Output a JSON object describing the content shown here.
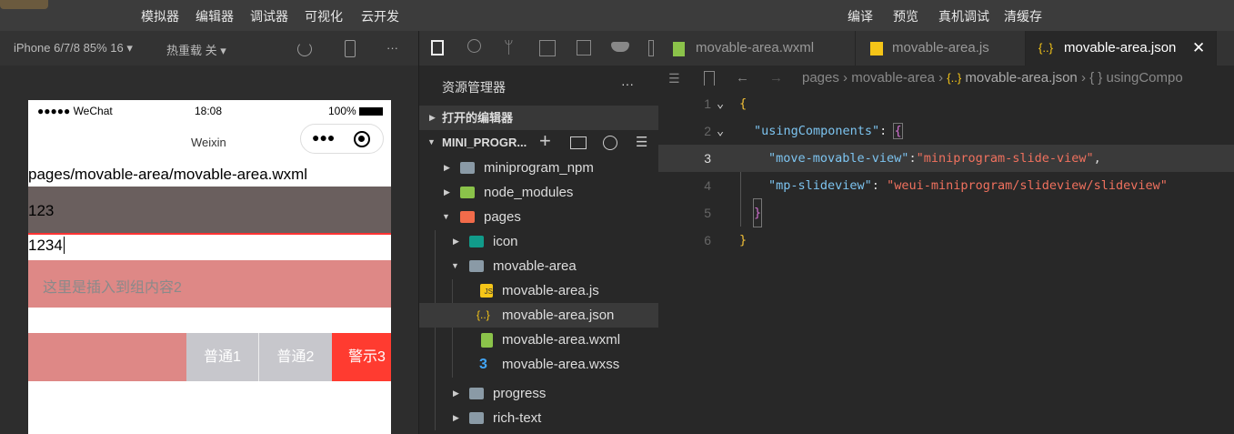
{
  "topbar": {
    "left_menu": [
      "模拟器",
      "编辑器",
      "调试器",
      "可视化",
      "云开发"
    ],
    "right_menu": [
      "编译",
      "预览",
      "真机调试",
      "清缓存"
    ]
  },
  "simulator": {
    "device": "iPhone 6/7/8 85% 16 ▾",
    "hot_reload": "热重载 关 ▾",
    "more": "···"
  },
  "phone": {
    "carrier": "●●●●● WeChat",
    "time": "18:08",
    "battery": "100%",
    "nav_title": "Weixin",
    "path": "pages/movable-area/movable-area.wxml",
    "block1": "123",
    "input_value": "1234",
    "insert_text": "这里是插入到组内容2",
    "slide_buttons": [
      "普通1",
      "普通2",
      "警示3"
    ],
    "colors": {
      "gray_block": "#6a5f5e",
      "pink": "#de8886",
      "btn_gray": "#c7c7cc",
      "btn_red": "#ff3b30"
    }
  },
  "explorer": {
    "title": "资源管理器",
    "more": "···",
    "open_editors": "打开的编辑器",
    "project": "MINI_PROGR...",
    "tree": [
      {
        "label": "miniprogram_npm",
        "icon": "folder-icon"
      },
      {
        "label": "node_modules",
        "icon": "node-folder-icon"
      },
      {
        "label": "pages",
        "icon": "pages-folder-icon"
      },
      {
        "label": "icon",
        "icon": "icon-folder-icon"
      },
      {
        "label": "movable-area",
        "icon": "folder-open-icon"
      },
      {
        "label": "movable-area.js",
        "icon": "js-file-icon"
      },
      {
        "label": "movable-area.json",
        "icon": "json-file-icon"
      },
      {
        "label": "movable-area.wxml",
        "icon": "wxml-file-icon"
      },
      {
        "label": "movable-area.wxss",
        "icon": "css-file-icon"
      },
      {
        "label": "progress",
        "icon": "folder-icon"
      },
      {
        "label": "rich-text",
        "icon": "folder-icon"
      }
    ]
  },
  "editor": {
    "tabs": [
      {
        "label": "movable-area.wxml"
      },
      {
        "label": "movable-area.js"
      },
      {
        "label": "movable-area.json",
        "active": true
      }
    ],
    "breadcrumb": [
      "pages",
      "movable-area",
      "movable-area.json",
      "usingCompo"
    ],
    "lines": [
      "1",
      "2",
      "3",
      "4",
      "5",
      "6"
    ],
    "code": {
      "l1": "{",
      "l2k": "\"usingComponents\"",
      "l2c": ": ",
      "l2b": "{",
      "l3k": "\"move-movable-view\"",
      "l3c": ":",
      "l3v": "\"miniprogram-slide-view\"",
      "l3e": ",",
      "l4k": "\"mp-slideview\"",
      "l4c": ": ",
      "l4v": "\"weui-miniprogram/slideview/slideview\"",
      "l5": "}",
      "l6": "}"
    }
  }
}
